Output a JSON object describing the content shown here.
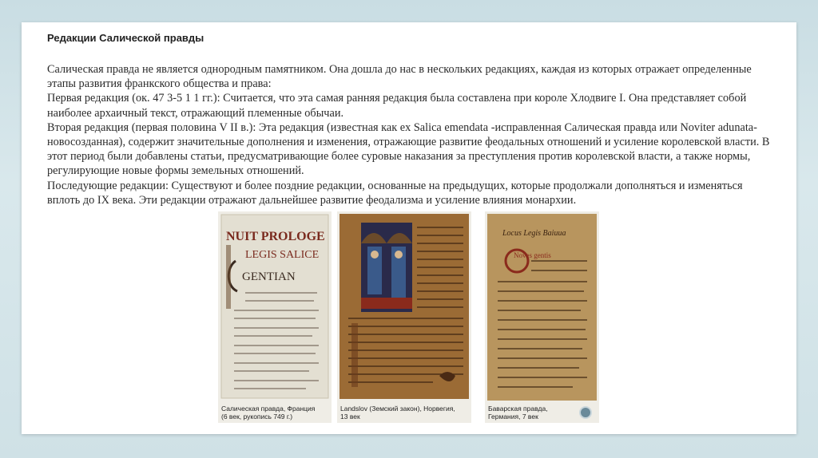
{
  "title": "Редакции Салической правды",
  "paragraphs": [
    "Салическая правда не является однородным памятником. Она дошла до нас в нескольких редакциях, каждая из которых отражает определенные этапы развития франкского общества и права:",
    "Первая редакция (ок. 47 3-5 1 1 гг.): Считается, что эта самая ранняя редакция была составлена при короле Хлодвиге I. Она представляет собой наиболее архаичный текст, отражающий племенные обычаи.",
    "Вторая редакция (первая половина V II в.): Эта редакция (известная как   ex Salica emendata -исправленная Салическая правда или Noviter adunata-новосозданная), содержит значительные дополнения и изменения, отражающие развитие феодальных отношений и усиление королевской власти. В этот период были добавлены статьи, предусматривающие более суровые наказания за преступления против королевской власти, а также нормы, регулирующие новые формы земельных отношений.",
    "Последующие редакции: Существуют и более поздние редакции, основанные на предыдущих, которые продолжали дополняться и изменяться вплоть до IX века. Эти редакции отражают дальнейшее развитие феодализма и усиление влияния монархии."
  ],
  "images": [
    {
      "caption_lines": [
        "Салическая правда, Франция",
        "(6 век, рукопись 749 г.)"
      ],
      "manuscript_heading": [
        "NUIT PROLOGE",
        "LEGIS SALICE",
        "GENTIAN"
      ]
    },
    {
      "caption_lines": [
        "Landslov (Земский закон), Норвегия,",
        "13 век"
      ]
    },
    {
      "caption_lines": [
        "Баварская правда,",
        "Германия, 7 век"
      ],
      "manuscript_heading": [
        "Locus Legis Baiuua",
        "Noves gentis"
      ]
    }
  ],
  "colors": {
    "background": "#cfe1e6",
    "slide": "#ffffff",
    "text": "#2b2b2b",
    "parchment_light": "#e3dfd2",
    "parchment_dark": "#9b6b35",
    "ink_red": "#8a2a1c"
  }
}
